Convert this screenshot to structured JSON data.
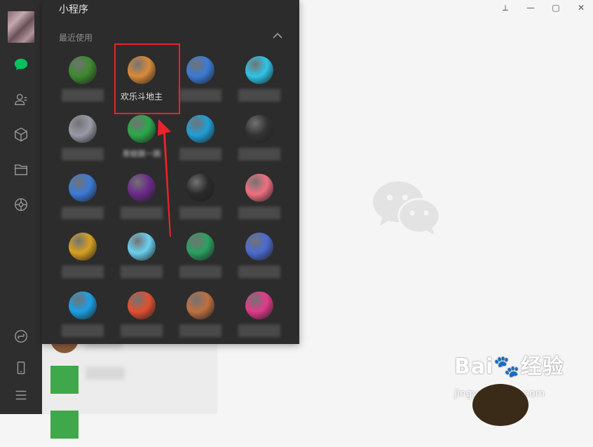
{
  "window": {
    "controls": [
      "pin-icon",
      "minimize-icon",
      "maximize-icon",
      "close-icon"
    ]
  },
  "sidebar": {
    "items": [
      "chat-icon",
      "contacts-icon",
      "favorites-icon",
      "files-icon",
      "moments-icon",
      "miniprogram-icon",
      "phone-icon",
      "menu-icon"
    ],
    "active_color": "#07c160"
  },
  "miniprogram_panel": {
    "title": "小程序",
    "recent_label": "最近使用",
    "apps": [
      {
        "name": "",
        "icon": "mahjong-icon",
        "color": "#3c8a2e"
      },
      {
        "name": "欢乐斗地主",
        "icon": "doudizhu-icon",
        "color": "#d98a3a",
        "highlighted": true
      },
      {
        "name": "",
        "icon": "paint-icon",
        "color": "#3a7bd5"
      },
      {
        "name": "",
        "icon": "bird-ball-icon",
        "color": "#2ec4e8"
      },
      {
        "name": "",
        "icon": "silhouette-icon",
        "color": "#9a9aa8"
      },
      {
        "name": "青蛙跳一跳",
        "icon": "frog-icon",
        "color": "#2aa84a"
      },
      {
        "name": "",
        "icon": "tower-ball-icon",
        "color": "#1f9fd8"
      },
      {
        "name": "",
        "icon": "cs-game-icon",
        "color": "#333333"
      },
      {
        "name": "",
        "icon": "blocks-icon",
        "color": "#3b7ad8"
      },
      {
        "name": "",
        "icon": "girl-avatar-icon",
        "color": "#6b2a8a"
      },
      {
        "name": "",
        "icon": "rocket-icon",
        "color": "#2a2a2a"
      },
      {
        "name": "",
        "icon": "pig-icon",
        "color": "#f07080"
      },
      {
        "name": "",
        "icon": "98k-icon",
        "color": "#d8a020"
      },
      {
        "name": "",
        "icon": "water-cup-icon",
        "color": "#6ad0f0"
      },
      {
        "name": "",
        "icon": "s-logo-icon",
        "color": "#2aa060"
      },
      {
        "name": "",
        "icon": "sunglasses-avatar-icon",
        "color": "#4a6ad0"
      },
      {
        "name": "",
        "icon": "play-icon",
        "color": "#1aa0e8"
      },
      {
        "name": "",
        "icon": "dragon-icon",
        "color": "#e05030"
      },
      {
        "name": "",
        "icon": "cowboy-icon",
        "color": "#c07040"
      },
      {
        "name": "",
        "icon": "eye-icon",
        "color": "#e03a8a"
      }
    ],
    "highlight_color": "#e8232a"
  },
  "watermark": {
    "logo_text": "Bai🐾经验",
    "url": "jingyan.baidu.com"
  }
}
